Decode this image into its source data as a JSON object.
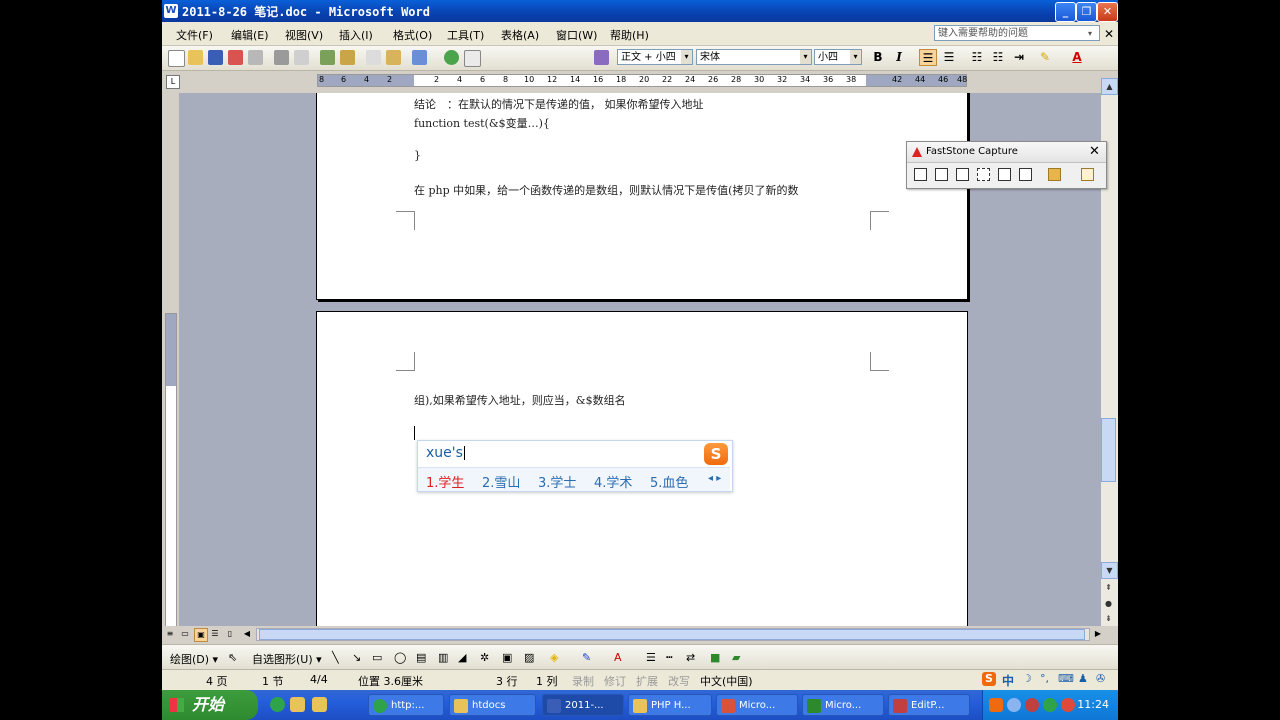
{
  "window": {
    "title": "2011-8-26 笔记.doc - Microsoft Word",
    "app_icon": "W",
    "controls": [
      "minimize-icon",
      "restore-icon",
      "close-icon"
    ]
  },
  "menu": {
    "items": [
      "文件(F)",
      "编辑(E)",
      "视图(V)",
      "插入(I)",
      "格式(O)",
      "工具(T)",
      "表格(A)",
      "窗口(W)",
      "帮助(H)"
    ],
    "help_placeholder": "键入需要帮助的问题"
  },
  "toolbar": {
    "style": "正文 + 小四",
    "font": "宋体",
    "size": "小四",
    "bold": "B",
    "italic": "I",
    "accent": "#f8d49a"
  },
  "ruler": {
    "numbers": [
      "8",
      "6",
      "4",
      "2",
      "2",
      "4",
      "6",
      "8",
      "10",
      "12",
      "14",
      "16",
      "18",
      "20",
      "22",
      "24",
      "26",
      "28",
      "30",
      "32",
      "34",
      "36",
      "38",
      "42",
      "44",
      "46",
      "48"
    ],
    "tab_selector": "L"
  },
  "document": {
    "page1_lines": [
      "结论　：在默认的情况下是传递的值，  如果你希望传入地址",
      "function test(&$变量…){",
      "}",
      "在 php 中如果，给一个函数传递的是数组，则默认情况下是传值(拷贝了新的数"
    ],
    "page2_lines": [
      "组),如果希望传入地址，则应当，&$数组名"
    ]
  },
  "ime": {
    "composition": "xue's",
    "candidates": [
      "1.学生",
      "2.雪山",
      "3.学士",
      "4.学术",
      "5.血色"
    ],
    "logo": "S",
    "pager": "◂ ▸"
  },
  "faststone": {
    "title": "FastStone Capture",
    "buttons": [
      "capture-window-icon",
      "capture-object-icon",
      "capture-rectangle-icon",
      "capture-freehand-icon",
      "capture-fullscreen-icon",
      "capture-scrolling-icon",
      "editor-icon",
      "settings-icon"
    ]
  },
  "drawbar": {
    "draw_label": "绘图(D) ▾",
    "autoshape_label": "自选图形(U) ▾"
  },
  "status": {
    "page": "4 页",
    "section": "1 节",
    "pages": "4/4",
    "position": "位置 3.6厘米",
    "row": "3 行",
    "col": "1 列",
    "rec": "录制",
    "trk": "修订",
    "ext": "扩展",
    "ovr": "改写",
    "lang": "中文(中国)"
  },
  "ime_status": {
    "mode": "中",
    "logo": "S"
  },
  "taskbar": {
    "start": "开始",
    "tasks": [
      "http:...",
      "htdocs",
      "2011-...",
      "PHP H...",
      "Micro...",
      "Micro...",
      "EditP..."
    ],
    "clock": "11:24"
  }
}
